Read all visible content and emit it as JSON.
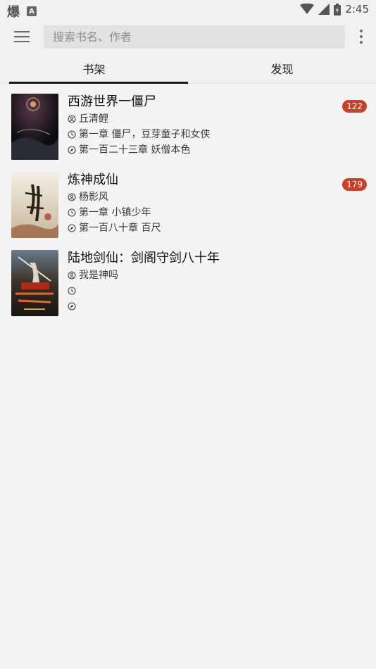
{
  "status_bar": {
    "app_glyph": "爆",
    "notification_icon": "A",
    "time": "2:45"
  },
  "search": {
    "placeholder": "搜索书名、作者",
    "value": ""
  },
  "tabs": [
    {
      "label": "书架",
      "active": true
    },
    {
      "label": "发现",
      "active": false
    }
  ],
  "books": [
    {
      "title": "西游世界一僵尸",
      "author": "丘清鲤",
      "last_read": "第一章 僵尸，豆芽童子和女侠",
      "latest": "第一百二十三章 妖僧本色",
      "unread_count": "122"
    },
    {
      "title": "炼神成仙",
      "author": "杨影风",
      "last_read": "第一章 小镇少年",
      "latest": "第一百八十章 百尺",
      "unread_count": "179"
    },
    {
      "title": "陆地剑仙：剑阁守剑八十年",
      "author": "我是神吗",
      "last_read": "",
      "latest": "",
      "unread_count": ""
    }
  ],
  "colors": {
    "accent": "#1a1a1a",
    "badge": "#c9412c",
    "background": "#f4f4f4"
  },
  "icons": {
    "menu": "hamburger-menu-icon",
    "more": "more-vertical-icon",
    "author": "person-circle-icon",
    "last_read": "clock-icon",
    "latest": "compass-icon"
  }
}
